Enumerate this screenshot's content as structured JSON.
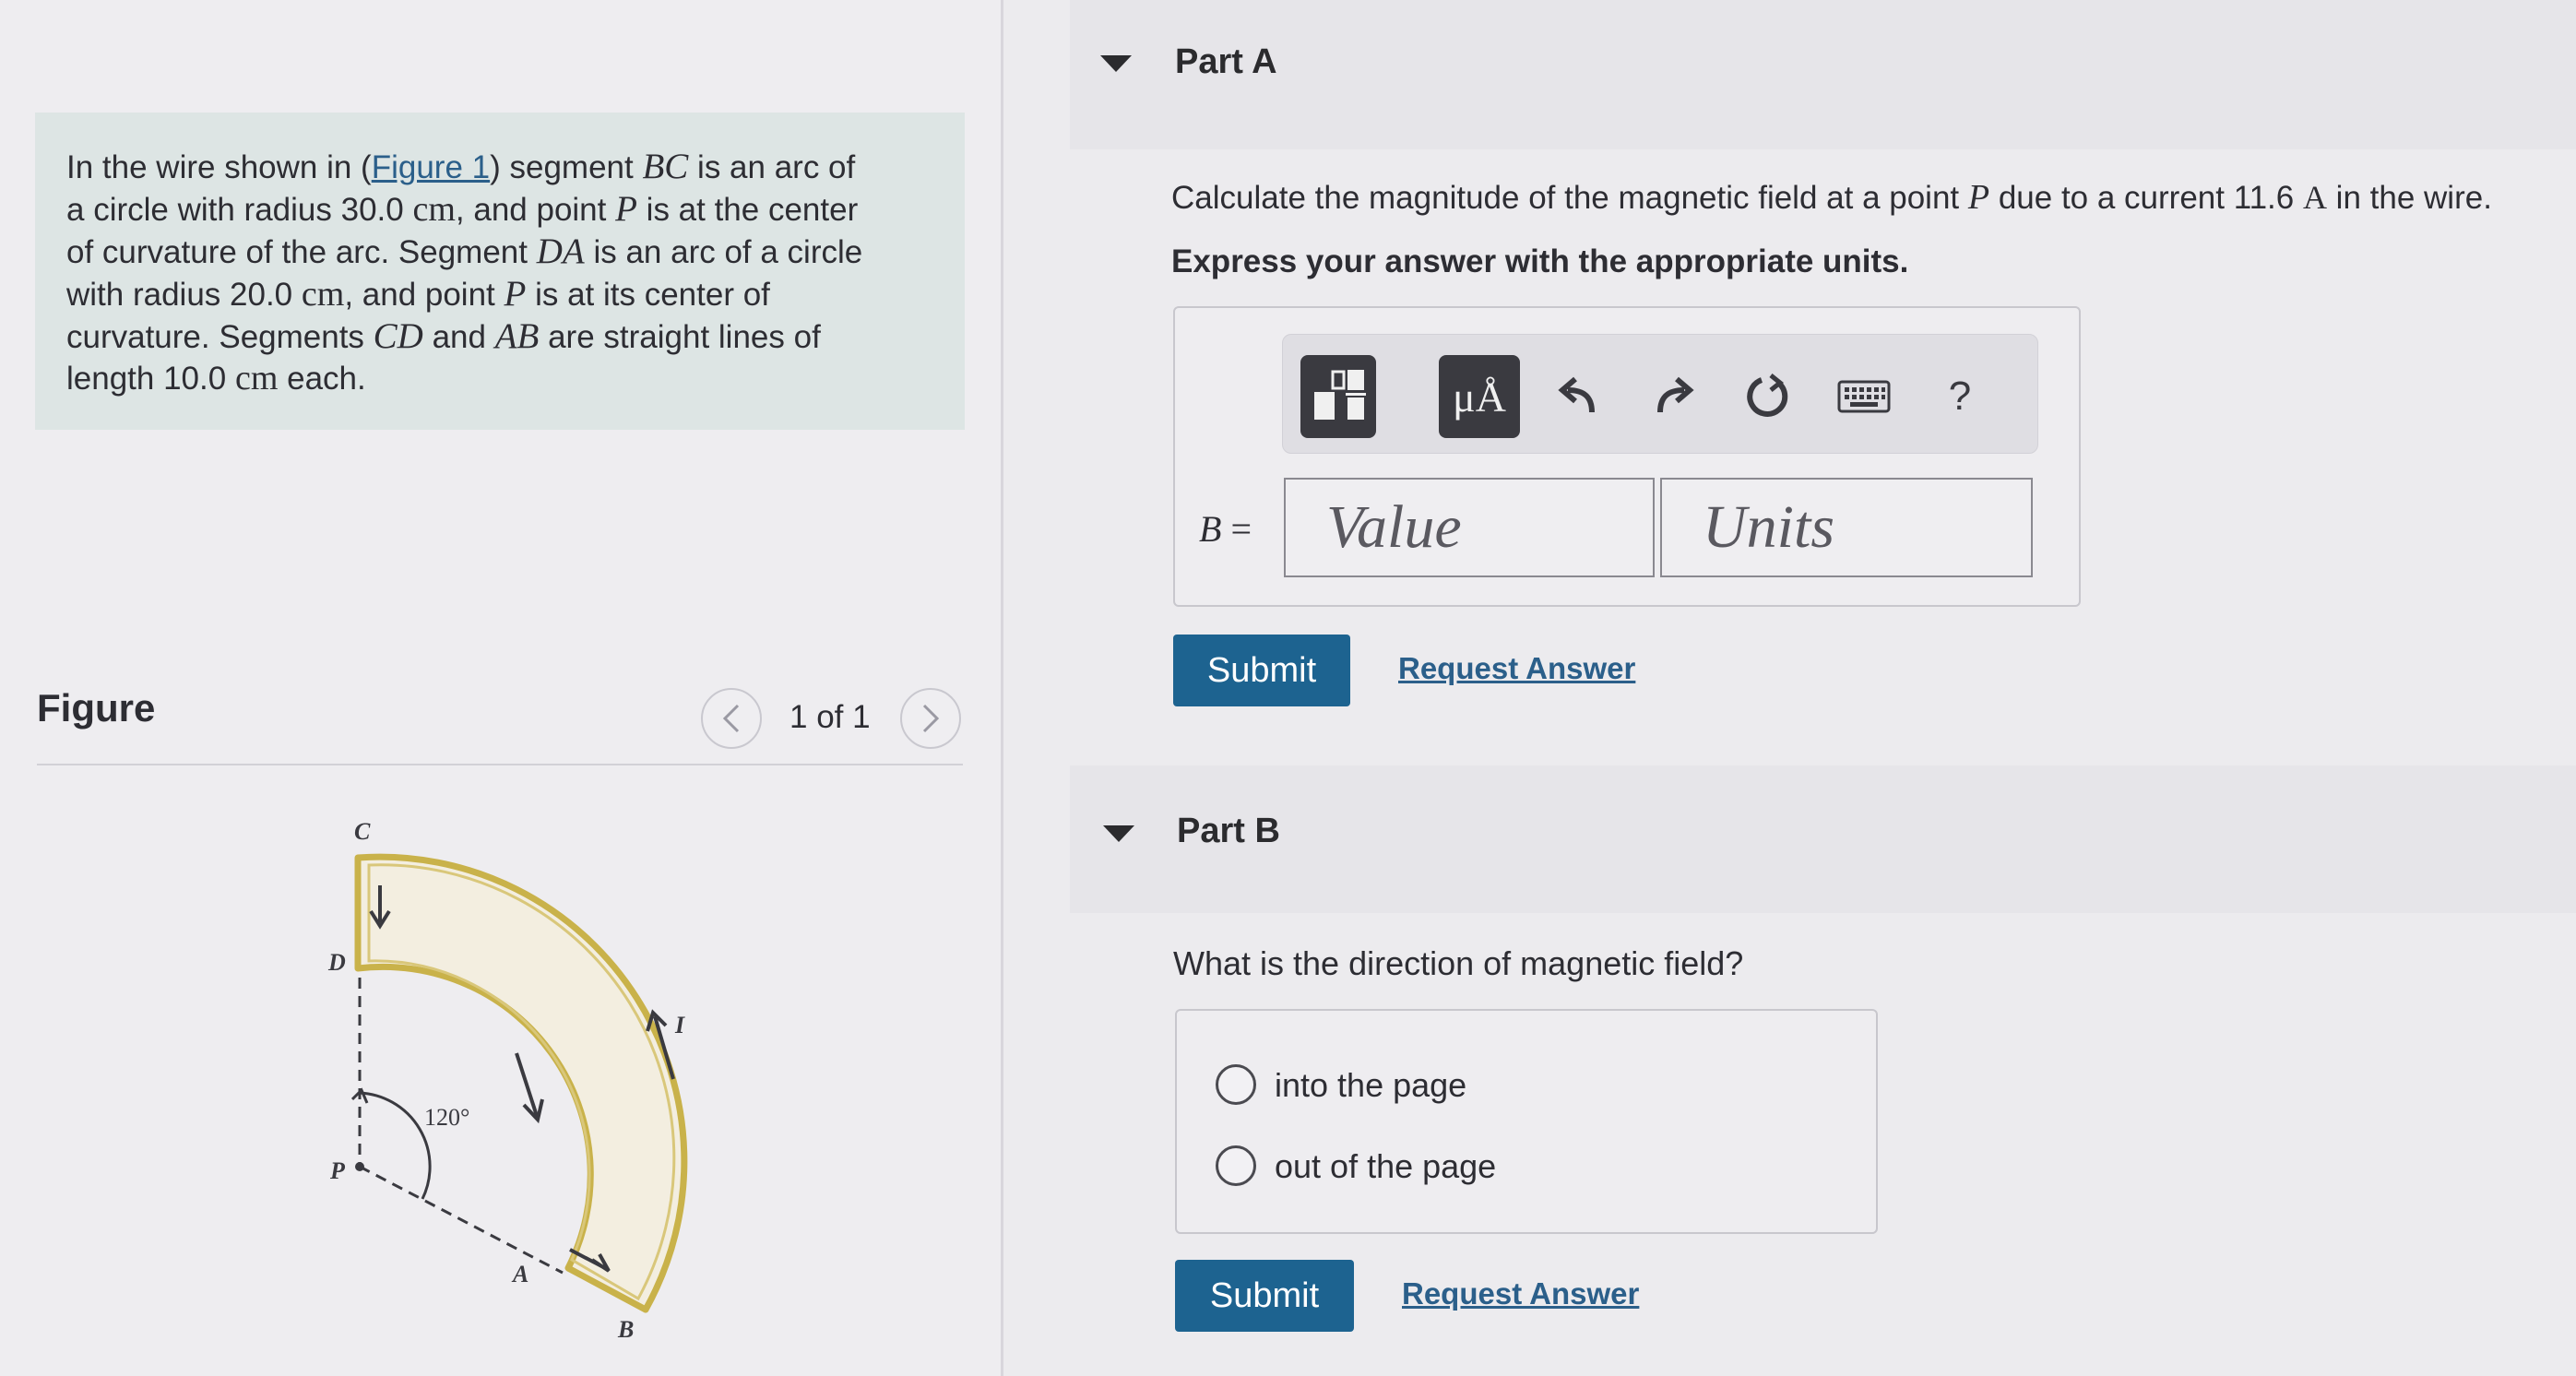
{
  "problem": {
    "t1": "In the wire shown in (",
    "figure_link": "Figure 1",
    "t2": ") segment ",
    "BC": "BC",
    "t3": " is an arc of",
    "t4": "a circle with radius 30.0",
    "unit_cm": "cm",
    "t5": ", and point ",
    "P": "P",
    "t6": " is at the center",
    "t7": "of curvature of the arc. Segment ",
    "DA": "DA",
    "t8": " is an arc of a circle",
    "t9": "with radius 20.0",
    "t10": ", and point ",
    "t11": " is at its center of",
    "t12": "curvature. Segments ",
    "CD": "CD",
    "t13": " and ",
    "AB": "AB",
    "t14": " are straight lines of",
    "t15": "length 10.0",
    "t16": " each."
  },
  "figure": {
    "title": "Figure",
    "prev_icon": "chevron-left-icon",
    "next_icon": "chevron-right-icon",
    "page_count": "1 of 1",
    "labels": {
      "C": "C",
      "D": "D",
      "P": "P",
      "A": "A",
      "B": "B",
      "I": "I",
      "angle": "120°"
    }
  },
  "partA": {
    "title": "Part A",
    "q1": "Calculate the magnitude of the magnetic field at a point ",
    "P": "P",
    "q2": " due to a current 11.6 ",
    "unit_A": "A",
    "q3": " in the wire.",
    "instruction": "Express your answer with the appropriate units.",
    "toolbar": {
      "template_icon": "templates-icon",
      "units_label": "μÅ",
      "undo_icon": "undo-icon",
      "redo_icon": "redo-icon",
      "reset_icon": "reset-icon",
      "keyboard_icon": "keyboard-icon",
      "help_label": "?"
    },
    "var_name": "B",
    "equals": " =",
    "value_placeholder": "Value",
    "units_placeholder": "Units",
    "submit": "Submit",
    "request": "Request Answer"
  },
  "partB": {
    "title": "Part B",
    "question": "What is the direction of magnetic field?",
    "options": [
      "into the page",
      "out of the page"
    ],
    "submit": "Submit",
    "request": "Request Answer"
  },
  "colors": {
    "accent": "#1d6390",
    "link": "#2b5f8a",
    "wire": "#c9b24a",
    "problem_bg": "#dde5e4"
  }
}
